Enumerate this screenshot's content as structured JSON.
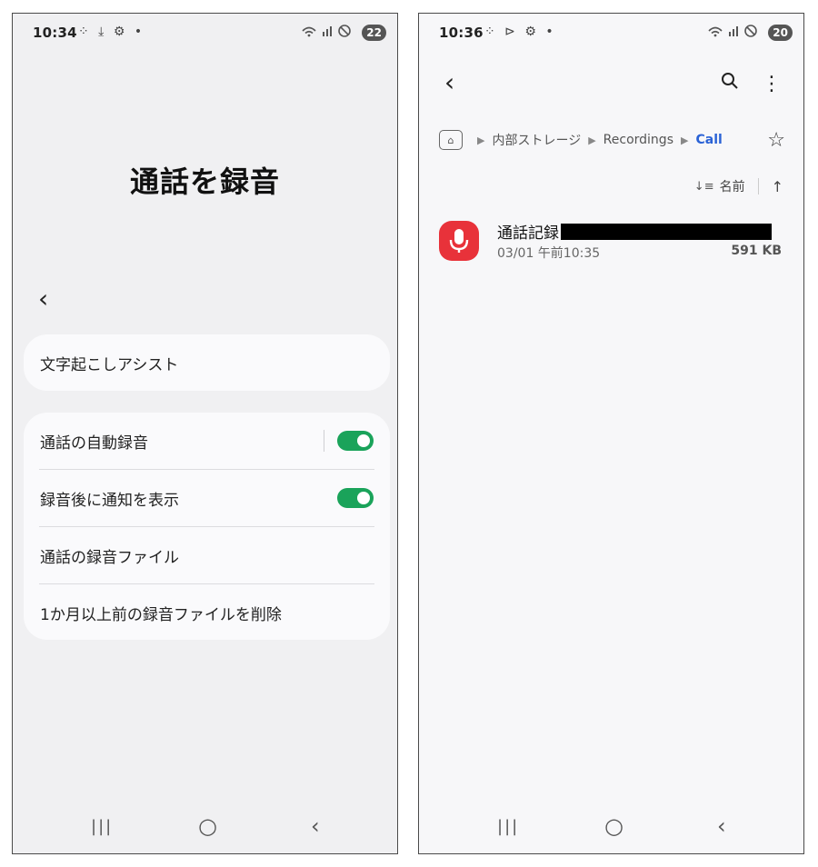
{
  "left_screen": {
    "status": {
      "time": "10:34",
      "left_icons": "⁘ ⤓ ⚙ •",
      "right_icons": "WiFi .ıl ⊘",
      "battery": "22"
    },
    "title": "通話を録音",
    "back_icon": "‹",
    "assist_label": "文字起こしアシスト",
    "settings": {
      "auto_record_label": "通話の自動録音",
      "auto_record_on": true,
      "notify_label": "録音後に通知を表示",
      "notify_on": true,
      "files_label": "通話の録音ファイル",
      "delete_label": "1か月以上前の録音ファイルを削除"
    },
    "nav": {
      "recent": "|||",
      "home": "○",
      "back": "‹"
    }
  },
  "right_screen": {
    "status": {
      "time": "10:36",
      "left_icons": "⁘ ⊳ ⚙ •",
      "right_icons": "WiFi .ıl ⊘",
      "battery": "20"
    },
    "back_icon": "‹",
    "search_icon": "⌕",
    "more_icon": "⋮",
    "breadcrumb": {
      "home_icon": "⌂",
      "items": [
        "内部ストレージ",
        "Recordings",
        "Call"
      ]
    },
    "favorite_icon": "☆",
    "sort": {
      "label": "名前",
      "icon": "↓≡",
      "direction_icon": "↑"
    },
    "file": {
      "name": "通話記録",
      "date": "03/01 午前10:35",
      "size": "591 KB"
    },
    "nav": {
      "recent": "|||",
      "home": "○",
      "back": "‹"
    }
  },
  "colors": {
    "accent_green": "#1aa35a",
    "mic_red": "#e8323a",
    "link_blue": "#2a62d6"
  }
}
